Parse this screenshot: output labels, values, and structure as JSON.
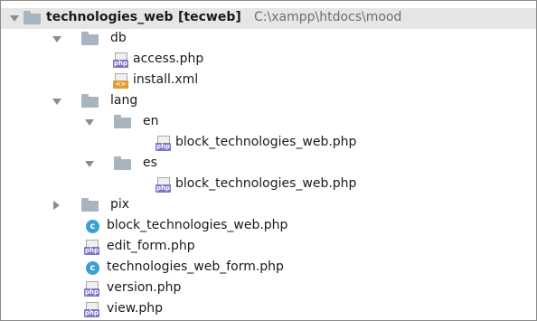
{
  "tree": {
    "root": {
      "name": "technologies_web",
      "module": "[tecweb]",
      "path": "C:\\xampp\\htdocs\\mood"
    },
    "db": {
      "name": "db",
      "files": [
        "access.php",
        "install.xml"
      ]
    },
    "lang": {
      "name": "lang",
      "en": {
        "name": "en",
        "file": "block_technologies_web.php"
      },
      "es": {
        "name": "es",
        "file": "block_technologies_web.php"
      }
    },
    "pix": {
      "name": "pix"
    },
    "files": [
      "block_technologies_web.php",
      "edit_form.php",
      "technologies_web_form.php",
      "version.php",
      "view.php"
    ]
  },
  "icons": {
    "php_tag": "php",
    "xml_tag": "<>",
    "class_tag": "c"
  },
  "colors": {
    "root_row_bg": "#e6e6e6",
    "folder": "#a8b4c0",
    "php_icon": "#7b77c6",
    "xml_icon": "#e89a2c",
    "class_icon": "#3a9fd6"
  }
}
